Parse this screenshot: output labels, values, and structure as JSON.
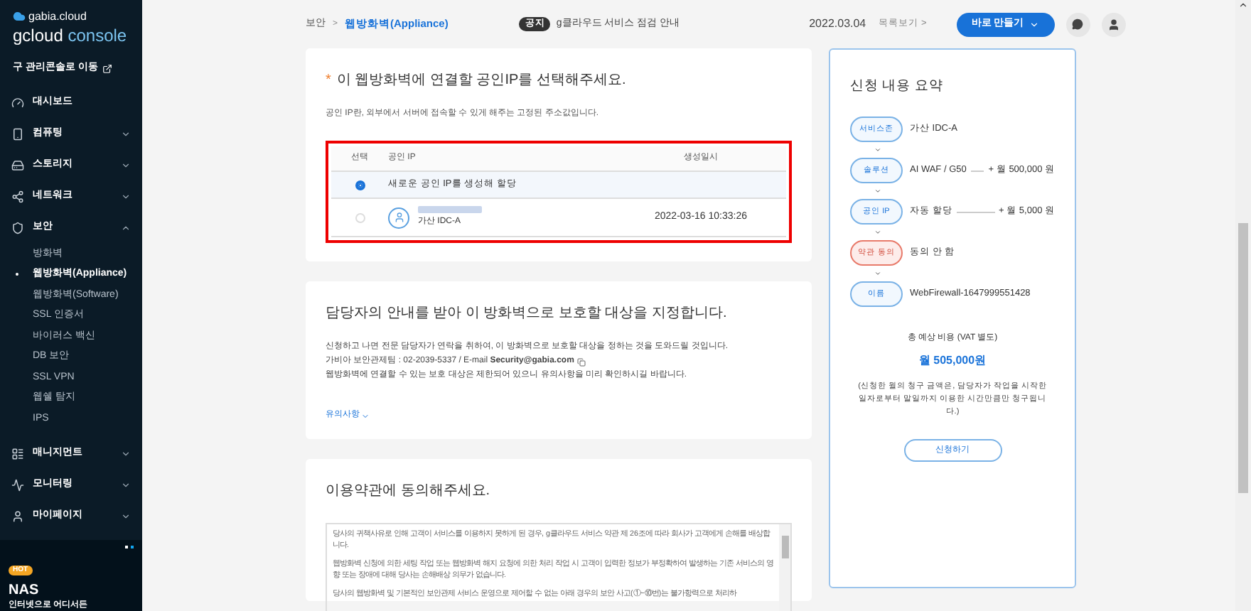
{
  "sidebar": {
    "brand_top": "gabia.cloud",
    "brand": "gcloud",
    "brand_suffix": "console",
    "legacy_link": "구 관리콘솔로 이동",
    "items": [
      {
        "label": "대시보드",
        "kind": "link"
      },
      {
        "label": "컴퓨팅",
        "kind": "group",
        "expanded": false
      },
      {
        "label": "스토리지",
        "kind": "group",
        "expanded": false
      },
      {
        "label": "네트워크",
        "kind": "group",
        "expanded": false
      },
      {
        "label": "보안",
        "kind": "group",
        "expanded": true,
        "children": [
          {
            "label": "방화벽",
            "selected": false
          },
          {
            "label": "웹방화벽(Appliance)",
            "selected": true
          },
          {
            "label": "웹방화벽(Software)",
            "selected": false
          },
          {
            "label": "SSL 인증서",
            "selected": false
          },
          {
            "label": "바이러스 백신",
            "selected": false
          },
          {
            "label": "DB 보안",
            "selected": false
          },
          {
            "label": "SSL VPN",
            "selected": false
          },
          {
            "label": "웹쉘 탐지",
            "selected": false
          },
          {
            "label": "IPS",
            "selected": false
          }
        ]
      },
      {
        "label": "매니지먼트",
        "kind": "group",
        "expanded": false
      },
      {
        "label": "모니터링",
        "kind": "group",
        "expanded": false
      },
      {
        "label": "마이페이지",
        "kind": "group",
        "expanded": false
      }
    ],
    "banner": {
      "dots": [
        {
          "selected": false
        },
        {
          "selected": true
        }
      ],
      "badge": "HOT",
      "title": "NAS",
      "text": "인터넷으로 어디서든"
    }
  },
  "topbar": {
    "breadcrumb": [
      "보안",
      "웹방화벽(Appliance)"
    ],
    "breadcrumb_separator": ">",
    "notice_badge": "공지",
    "notice": "g클라우드 서비스 점검 안내",
    "notice_date": "2022.03.04",
    "list_link": "목록보기 >",
    "create_button": "바로 만들기"
  },
  "ip_section": {
    "required_mark": "*",
    "title": "이 웹방화벽에 연결할 공인IP를 선택해주세요.",
    "description": "공인 IP란, 외부에서 서버에 접속할 수 있게 해주는 고정된 주소값입니다.",
    "columns": [
      "선택",
      "공인 IP",
      "생성일시"
    ],
    "rows": [
      {
        "kind": "new",
        "label": "새로운 공인 IP를 생성해 할당",
        "selected": true
      },
      {
        "kind": "existing",
        "zone": "가산 IDC-A",
        "created": "2022-03-16 10:33:26",
        "selected": false
      }
    ]
  },
  "target_section": {
    "title": "담당자의 안내를 받아 이 방화벽으로 보호할 대상을 지정합니다.",
    "lines": [
      "신청하고 나면 전문 담당자가 연락을 취하여, 이 방화벽으로 보호할 대상을 정하는 것을 도와드릴 것입니다.",
      "가비아 보안관제팀 : 02-2039-5337 / E-mail **Security@gabia.com**",
      "웹방화벽에 연결할 수 있는 보호 대상은 제한되어 있으니 유의사항을 미리 확인하시길 바랍니다."
    ],
    "notes_link": "유의사항"
  },
  "terms_section": {
    "title": "이용약관에 동의해주세요.",
    "paragraphs": [
      "당사의 귀책사유로 인해 고객이 서비스를 이용하지 못하게 된 경우, g클라우드 서비스 약관 제 26조에 따라 회사가 고객에게 손해를 배상합니다.",
      "웹방화벽 신청에 의한 세팅 작업 또는 웹방화벽 해지 요청에 의한 처리 작업 시 고객이 입력한 정보가 부정확하여 발생하는 기존 서비스의 영향 또는 장애에 대해 당사는 손해배상 의무가 없습니다.",
      "당사의 웹방화벽 및 기본적인 보안관제 서비스 운영으로 제어할 수 없는 아래 경우의 보안 사고(①~⑩번)는 불가항력으로 처리하"
    ]
  },
  "summary": {
    "title": "신청 내용 요약",
    "steps": [
      {
        "label": "서비스존",
        "value": "가산 IDC-A",
        "pending": false
      },
      {
        "label": "솔루션",
        "value": "AI WAF / G50",
        "price": "+ 월 500,000 원",
        "pending": false
      },
      {
        "label": "공인 IP",
        "value": "자동 할당",
        "price": "+ 월 5,000 원",
        "pending": false
      },
      {
        "label": "약관 동의",
        "value": "동의 안 함",
        "pending": true
      },
      {
        "label": "이름",
        "value": "WebFirewall-1647999551428",
        "pending": false
      }
    ],
    "total_label": "총 예상 비용 (VAT 별도)",
    "total": "월 505,000원",
    "note": "(신청한 월의 청구 금액은, 담당자가 작업을 시작한 일자로부터 말일까지 이용한 시간만큼만 청구됩니다.)",
    "submit": "신청하기"
  }
}
